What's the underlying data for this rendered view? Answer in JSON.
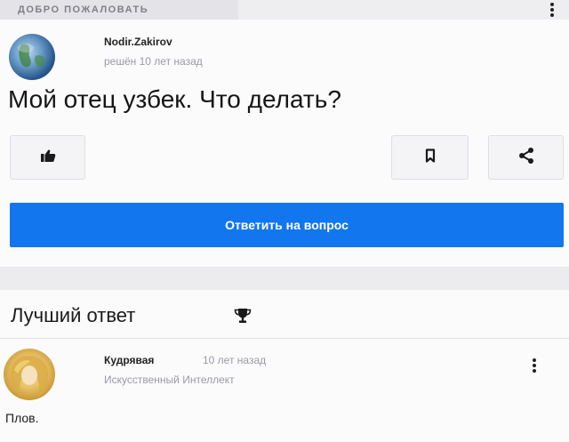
{
  "header": {
    "welcome": "ДОБРО ПОЖАЛОВАТЬ",
    "menu_icon": "more-vertical-icon"
  },
  "question": {
    "author": "Nodir.Zakirov",
    "meta": "решён 10 лет назад",
    "text": "Мой отец узбек. Что делать?",
    "actions": {
      "like_icon": "thumbs-up-icon",
      "save_icon": "bookmark-icon",
      "share_icon": "share-icon"
    },
    "answer_button": "Ответить на вопрос"
  },
  "best_answer": {
    "title": "Лучший ответ",
    "title_icon": "trophy-icon",
    "author": "Кудрявая",
    "time": "10 лет назад",
    "role": "Искусственный Интеллект",
    "text": "Плов.",
    "menu_icon": "more-vertical-icon"
  },
  "colors": {
    "accent": "#1277ee",
    "muted_text": "#9a9aa2"
  }
}
